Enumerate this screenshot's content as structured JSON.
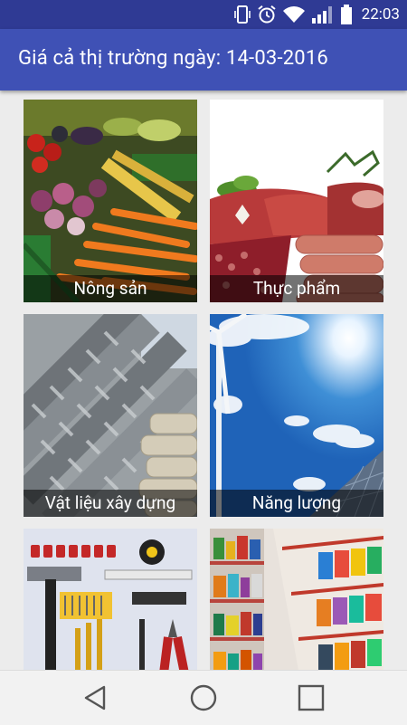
{
  "status_bar": {
    "time": "22:03"
  },
  "header": {
    "title": "Giá cả thị trường ngày: 14-03-2016"
  },
  "categories": [
    {
      "label": "Nông sản"
    },
    {
      "label": "Thực phẩm"
    },
    {
      "label": "Vật liệu xây dựng"
    },
    {
      "label": "Năng lượng"
    },
    {
      "label": ""
    },
    {
      "label": ""
    }
  ],
  "colors": {
    "status_bar": "#2f3a94",
    "app_bar": "#3f51b5",
    "background": "#ececec"
  }
}
